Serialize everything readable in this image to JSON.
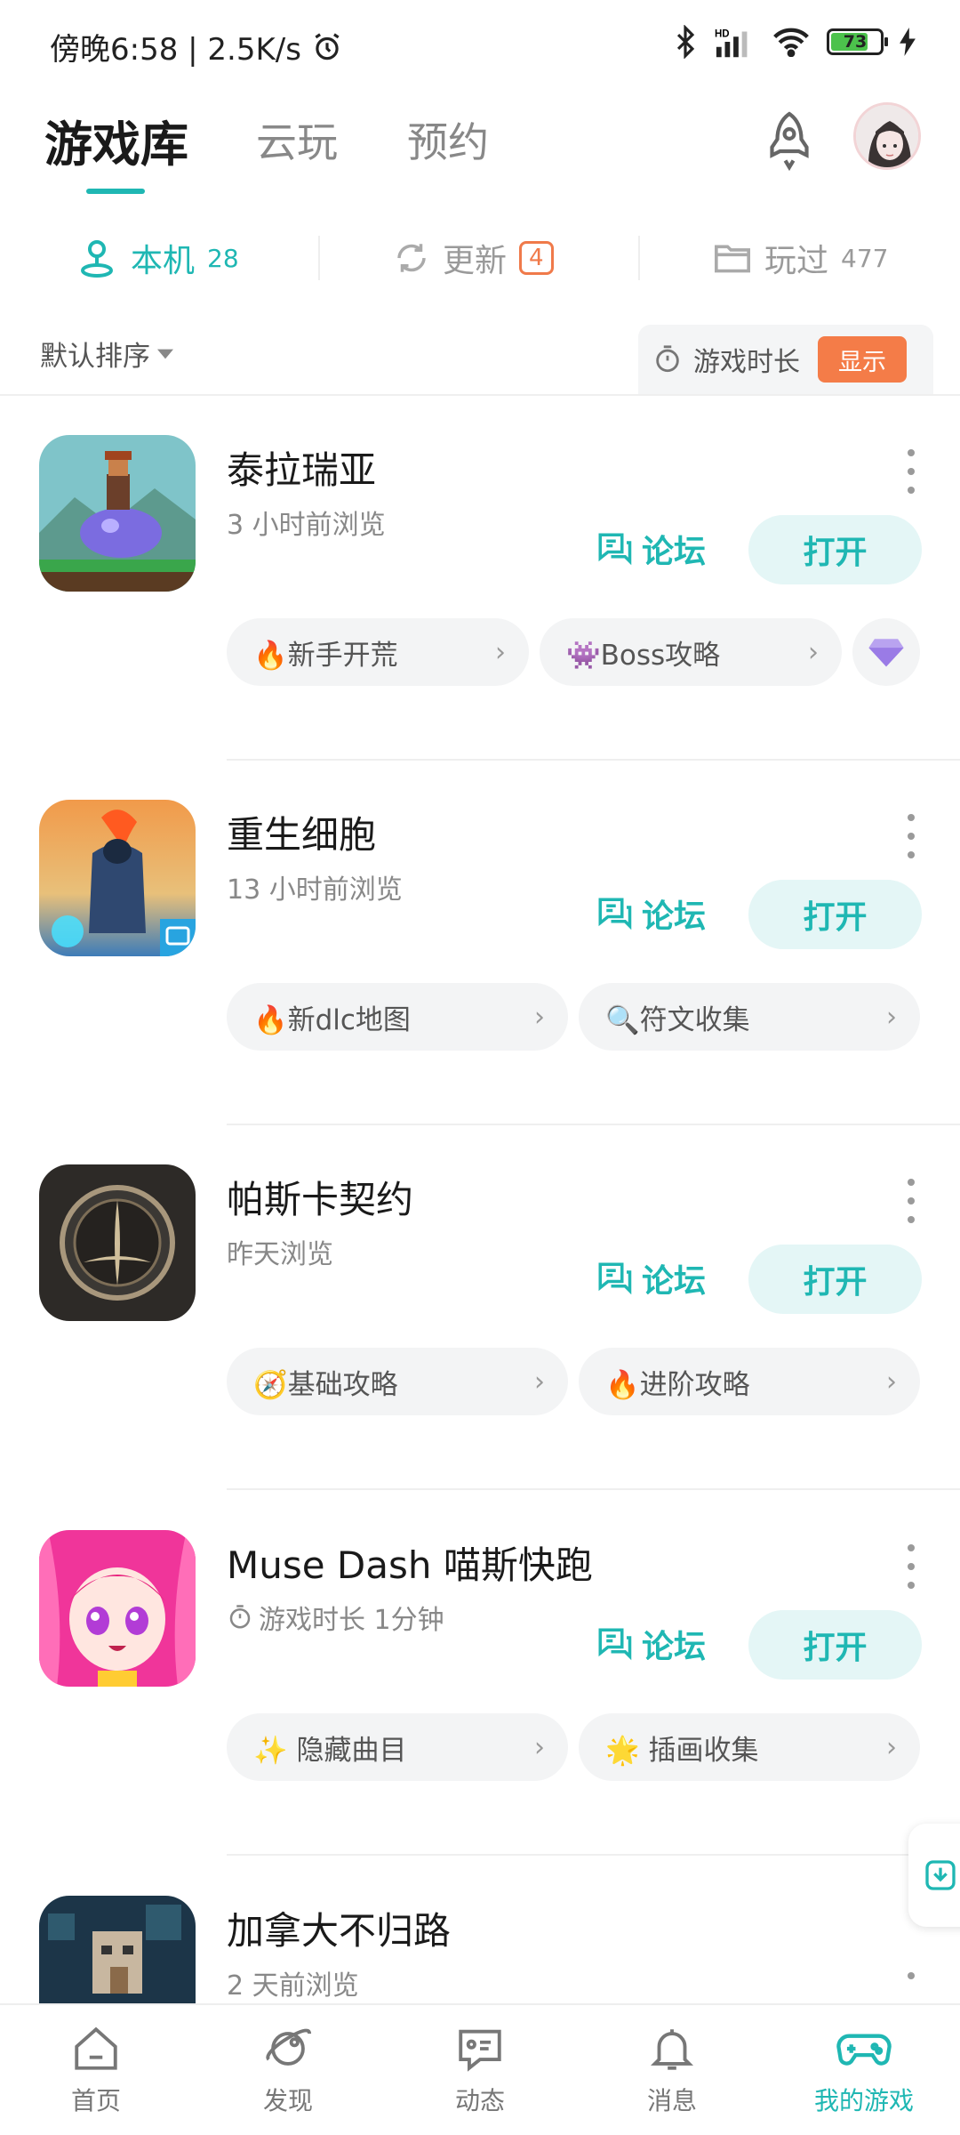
{
  "status_bar": {
    "time_text": "傍晚6:58 | 2.5K/s",
    "battery_level": "73"
  },
  "header": {
    "tabs": [
      {
        "label": "游戏库",
        "active": true
      },
      {
        "label": "云玩",
        "active": false
      },
      {
        "label": "预约",
        "active": false
      }
    ]
  },
  "subtabs": [
    {
      "label": "本机",
      "count": "28",
      "icon": "user-icon",
      "active": true
    },
    {
      "label": "更新",
      "count": "4",
      "icon": "refresh-icon",
      "active": false
    },
    {
      "label": "玩过",
      "count": "477",
      "icon": "folder-icon",
      "active": false
    }
  ],
  "sort": {
    "label": "默认排序",
    "playtime_label": "游戏时长",
    "show_label": "显示"
  },
  "games": [
    {
      "title": "泰拉瑞亚",
      "subtitle": "3 小时前浏览",
      "forum_label": "论坛",
      "open_label": "打开",
      "chips": [
        {
          "label": "🔥新手开荒"
        },
        {
          "label": "👾Boss攻略"
        }
      ]
    },
    {
      "title": "重生细胞",
      "subtitle": "13 小时前浏览",
      "forum_label": "论坛",
      "open_label": "打开",
      "chips": [
        {
          "label": "🔥新dlc地图"
        },
        {
          "label": "🔍符文收集"
        }
      ]
    },
    {
      "title": "帕斯卡契约",
      "subtitle": "昨天浏览",
      "forum_label": "论坛",
      "open_label": "打开",
      "chips": [
        {
          "label": "🧭基础攻略"
        },
        {
          "label": "🔥进阶攻略"
        }
      ]
    },
    {
      "title": "Muse Dash 喵斯快跑",
      "subtitle": "游戏时长 1分钟",
      "forum_label": "论坛",
      "open_label": "打开",
      "chips": [
        {
          "label": "✨ 隐藏曲目"
        },
        {
          "label": "🌟 插画收集"
        }
      ]
    },
    {
      "title": "加拿大不归路",
      "subtitle": "2 天前浏览"
    }
  ],
  "bottom_nav": [
    {
      "label": "首页",
      "icon": "home-icon",
      "active": false
    },
    {
      "label": "发现",
      "icon": "planet-icon",
      "active": false
    },
    {
      "label": "动态",
      "icon": "chat-icon",
      "active": false
    },
    {
      "label": "消息",
      "icon": "bell-icon",
      "active": false
    },
    {
      "label": "我的游戏",
      "icon": "gamepad-icon",
      "active": true
    }
  ],
  "colors": {
    "accent": "#1fb7b3",
    "orange": "#f47c48"
  }
}
